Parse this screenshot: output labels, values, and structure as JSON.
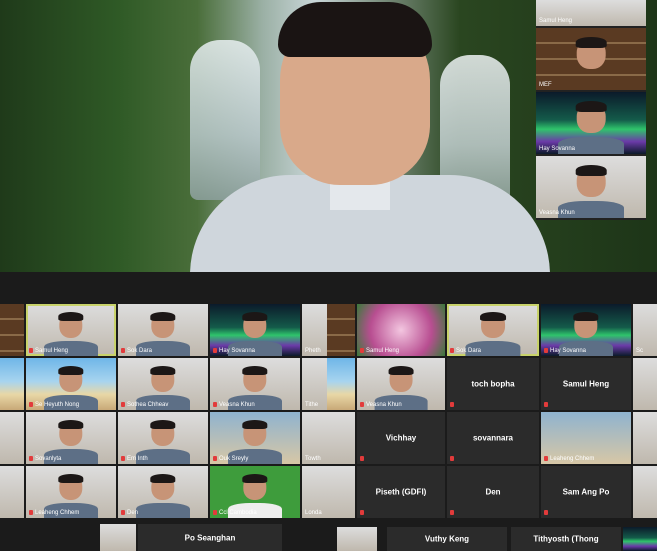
{
  "speaker": {
    "name": "main-speaker"
  },
  "sidebar": {
    "tiles": [
      {
        "name": "Samul Heng",
        "bg": "room"
      },
      {
        "name": "MEF",
        "bg": "shelf"
      },
      {
        "name": "Hay Sovanna",
        "bg": "aurora"
      },
      {
        "name": "Veasna Khun",
        "bg": "room"
      }
    ]
  },
  "left_gallery": {
    "rows": [
      [
        {
          "name": "",
          "bg": "shelf"
        },
        {
          "name": "Samul Heng",
          "bg": "room",
          "hl": true
        },
        {
          "name": "Sok Dara",
          "bg": "room"
        },
        {
          "name": "Hay Sovanna",
          "bg": "aurora"
        },
        {
          "name": "Pheth",
          "bg": "room"
        }
      ],
      [
        {
          "name": "",
          "bg": "beach"
        },
        {
          "name": "Se Heyuth Nong",
          "bg": "beach"
        },
        {
          "name": "Sothea Chheav",
          "bg": "room"
        },
        {
          "name": "Veasna Khun",
          "bg": "room"
        },
        {
          "name": "Tithe",
          "bg": "room"
        }
      ],
      [
        {
          "name": "",
          "bg": "room"
        },
        {
          "name": "Sovanlyta",
          "bg": "room"
        },
        {
          "name": "Em Inth",
          "bg": "room"
        },
        {
          "name": "Ouk Sreyly",
          "bg": "city"
        },
        {
          "name": "Towth",
          "bg": "room"
        }
      ],
      [
        {
          "name": "",
          "bg": "room"
        },
        {
          "name": "Leaheng Chhem",
          "bg": "room"
        },
        {
          "name": "Den",
          "bg": "room"
        },
        {
          "name": "Ccl Cambodia",
          "bg": "green"
        },
        {
          "name": "Londa",
          "bg": "room"
        }
      ]
    ],
    "bottom_label": "Po Seanghan"
  },
  "right_gallery": {
    "rows": [
      [
        {
          "name": "",
          "bg": "shelf"
        },
        {
          "name": "Samul Heng",
          "bg": "pink"
        },
        {
          "name": "Sok Dara",
          "bg": "room",
          "hl": true
        },
        {
          "name": "Hay Sovanna",
          "bg": "aurora"
        },
        {
          "name": "Sc",
          "bg": "room"
        }
      ],
      [
        {
          "name": "",
          "bg": "beach"
        },
        {
          "name": "Veasna Khun",
          "bg": "room"
        },
        {
          "big": "toch bopha"
        },
        {
          "big": "Samul Heng"
        },
        {
          "name": "",
          "bg": "room"
        }
      ],
      [
        {
          "name": "",
          "bg": "room"
        },
        {
          "big": "Vichhay"
        },
        {
          "big": "sovannara"
        },
        {
          "name": "Leaheng Chhem",
          "bg": "city"
        },
        {
          "name": "",
          "bg": "room"
        }
      ],
      [
        {
          "name": "",
          "bg": "room"
        },
        {
          "big": "Piseth (GDFI)"
        },
        {
          "big": "Den"
        },
        {
          "big": "Sam Ang Po"
        },
        {
          "name": "",
          "bg": "room"
        }
      ]
    ],
    "bottom_a": "Vuthy Keng",
    "bottom_b": "Tithyosth (Thong"
  }
}
